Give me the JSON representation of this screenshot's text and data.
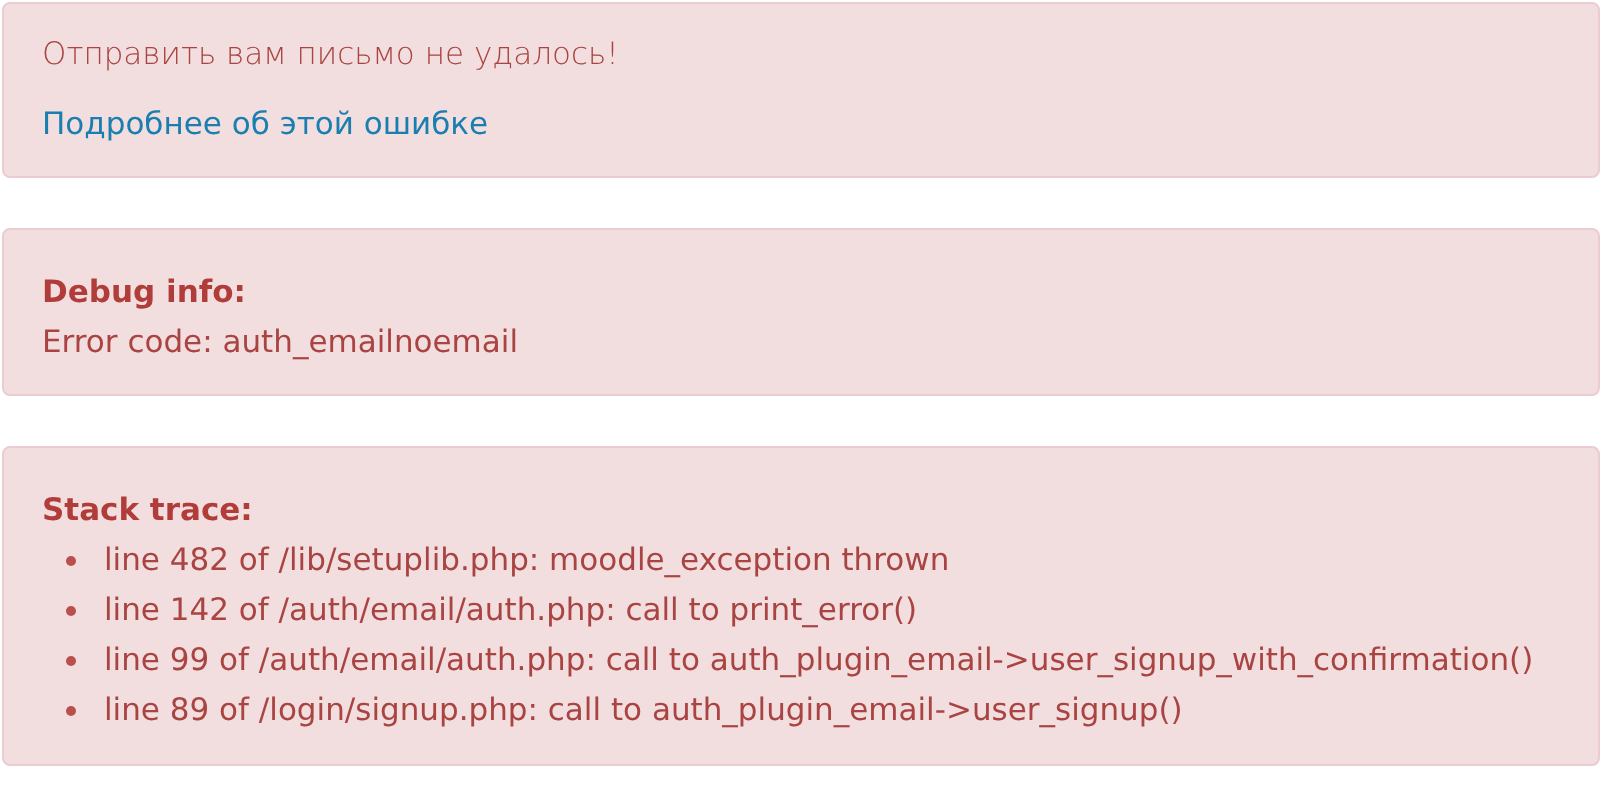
{
  "error_message": {
    "text": "Отправить вам письмо не удалось!",
    "link": "Подробнее об этой ошибке"
  },
  "debug_info": {
    "title": "Debug info:",
    "error_code": "Error code: auth_emailnoemail"
  },
  "stack_trace": {
    "title": "Stack trace:",
    "items": [
      "line 482 of /lib/setuplib.php: moodle_exception thrown",
      "line 142 of /auth/email/auth.php: call to print_error()",
      "line 99 of /auth/email/auth.php: call to auth_plugin_email->user_signup_with_confirmation()",
      "line 89 of /login/signup.php: call to auth_plugin_email->user_signup()"
    ]
  }
}
